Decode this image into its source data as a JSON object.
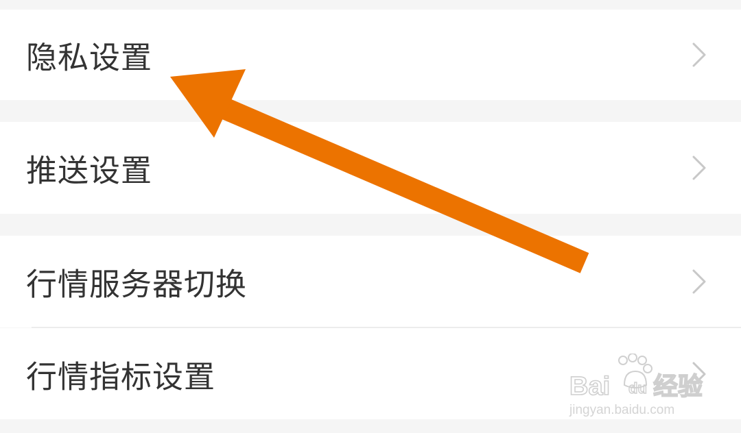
{
  "settings": {
    "items": [
      {
        "label": "隐私设置",
        "icon": "chevron-right-icon"
      },
      {
        "label": "推送设置",
        "icon": "chevron-right-icon"
      },
      {
        "label": "行情服务器切换",
        "icon": "chevron-right-icon"
      },
      {
        "label": "行情指标设置",
        "icon": "chevron-right-icon"
      }
    ]
  },
  "annotation": {
    "icon": "arrow-icon",
    "color": "#ec7300"
  },
  "watermark": {
    "brand": "Bai du 经验",
    "url": "jingyan.baidu.com"
  },
  "colors": {
    "background": "#f5f5f5",
    "row": "#ffffff",
    "text": "#333333",
    "chevron": "#c8c8c8"
  }
}
